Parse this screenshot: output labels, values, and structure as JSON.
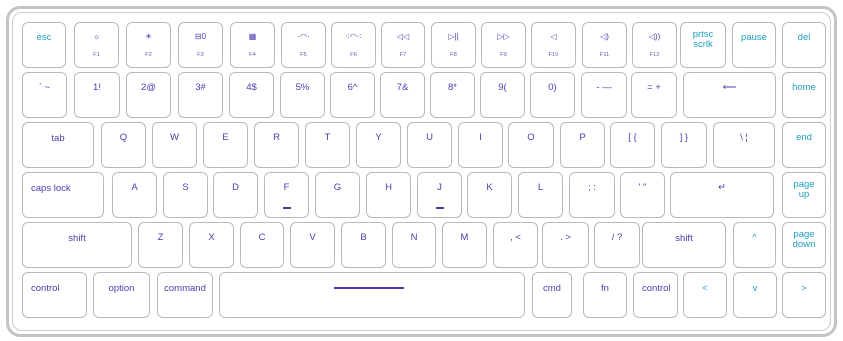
{
  "colors": {
    "primary": "#4a3cb0",
    "accent": "#1e9fbf",
    "key_border": "#b9b9b9",
    "frame": "#c4c4c4"
  },
  "rows": [
    [
      {
        "id": "esc",
        "label": "esc",
        "cyan": true
      },
      {
        "id": "f1",
        "icon": "☼",
        "fn": "F1"
      },
      {
        "id": "f2",
        "icon": "☀",
        "fn": "F2"
      },
      {
        "id": "f3",
        "icon": "⊟0",
        "fn": "F3"
      },
      {
        "id": "f4",
        "icon": "▦",
        "fn": "F4"
      },
      {
        "id": "f5",
        "icon": "·◠·",
        "fn": "F5"
      },
      {
        "id": "f6",
        "icon": "⁖◠⁖",
        "fn": "F6"
      },
      {
        "id": "f7",
        "icon": "◁◁",
        "fn": "F7"
      },
      {
        "id": "f8",
        "icon": "▷||",
        "fn": "F8"
      },
      {
        "id": "f9",
        "icon": "▷▷",
        "fn": "F9"
      },
      {
        "id": "f10",
        "icon": "◁",
        "fn": "F10"
      },
      {
        "id": "f11",
        "icon": "◁)",
        "fn": "F11"
      },
      {
        "id": "f12",
        "icon": "◁))",
        "fn": "F12"
      },
      {
        "id": "prtsc",
        "line1": "prtsc",
        "line2": "scrlk",
        "cyan": true
      },
      {
        "id": "pause",
        "label": "pause",
        "cyan": true
      },
      {
        "id": "del",
        "label": "del",
        "cyan": true
      }
    ],
    [
      {
        "id": "backtick",
        "label": "` ~"
      },
      {
        "id": "1",
        "label": "1!"
      },
      {
        "id": "2",
        "label": "2@"
      },
      {
        "id": "3",
        "label": "3#"
      },
      {
        "id": "4",
        "label": "4$"
      },
      {
        "id": "5",
        "label": "5%"
      },
      {
        "id": "6",
        "label": "6^"
      },
      {
        "id": "7",
        "label": "7&"
      },
      {
        "id": "8",
        "label": "8*"
      },
      {
        "id": "9",
        "label": "9("
      },
      {
        "id": "0",
        "label": "0)"
      },
      {
        "id": "minus",
        "label": "- —"
      },
      {
        "id": "equals",
        "label": "= +"
      },
      {
        "id": "backspace",
        "label": "⟵"
      },
      {
        "id": "home",
        "label": "home",
        "cyan": true
      }
    ],
    [
      {
        "id": "tab",
        "label": "tab"
      },
      {
        "id": "q",
        "label": "Q"
      },
      {
        "id": "w",
        "label": "W"
      },
      {
        "id": "e",
        "label": "E"
      },
      {
        "id": "r",
        "label": "R"
      },
      {
        "id": "t",
        "label": "T"
      },
      {
        "id": "y",
        "label": "Y"
      },
      {
        "id": "u",
        "label": "U"
      },
      {
        "id": "i",
        "label": "I"
      },
      {
        "id": "o",
        "label": "O"
      },
      {
        "id": "p",
        "label": "P"
      },
      {
        "id": "lbracket",
        "label": "[ {"
      },
      {
        "id": "rbracket",
        "label": "] }"
      },
      {
        "id": "backslash",
        "label": "\\ ¦"
      },
      {
        "id": "end",
        "label": "end",
        "cyan": true
      }
    ],
    [
      {
        "id": "capslock",
        "label": "caps lock"
      },
      {
        "id": "a",
        "label": "A"
      },
      {
        "id": "s",
        "label": "S"
      },
      {
        "id": "d",
        "label": "D"
      },
      {
        "id": "f",
        "label": "F"
      },
      {
        "id": "g",
        "label": "G"
      },
      {
        "id": "h",
        "label": "H"
      },
      {
        "id": "j",
        "label": "J"
      },
      {
        "id": "k",
        "label": "K"
      },
      {
        "id": "l",
        "label": "L"
      },
      {
        "id": "semicolon",
        "label": "; :"
      },
      {
        "id": "quote",
        "label": "' \""
      },
      {
        "id": "enter",
        "label": "↵"
      },
      {
        "id": "pageup",
        "line1": "page",
        "line2": "up",
        "cyan": true
      }
    ],
    [
      {
        "id": "lshift",
        "label": "shift"
      },
      {
        "id": "z",
        "label": "Z"
      },
      {
        "id": "x",
        "label": "X"
      },
      {
        "id": "c",
        "label": "C"
      },
      {
        "id": "v",
        "label": "V"
      },
      {
        "id": "b",
        "label": "B"
      },
      {
        "id": "n",
        "label": "N"
      },
      {
        "id": "m",
        "label": "M"
      },
      {
        "id": "comma",
        "label": ", <"
      },
      {
        "id": "period",
        "label": ". >"
      },
      {
        "id": "slash",
        "label": "/ ?"
      },
      {
        "id": "rshift",
        "label": "shift"
      },
      {
        "id": "up",
        "label": "^",
        "cyan": true
      },
      {
        "id": "pagedown",
        "line1": "page",
        "line2": "down",
        "cyan": true
      }
    ],
    [
      {
        "id": "lcontrol",
        "label": "control"
      },
      {
        "id": "option",
        "label": "option"
      },
      {
        "id": "command",
        "label": "command"
      },
      {
        "id": "space",
        "label": ""
      },
      {
        "id": "cmd",
        "label": "cmd"
      },
      {
        "id": "fn",
        "label": "fn"
      },
      {
        "id": "rcontrol",
        "label": "control"
      },
      {
        "id": "left",
        "label": "<",
        "cyan": true
      },
      {
        "id": "down",
        "label": "v",
        "cyan": true
      },
      {
        "id": "right",
        "label": ">",
        "cyan": true
      }
    ]
  ]
}
